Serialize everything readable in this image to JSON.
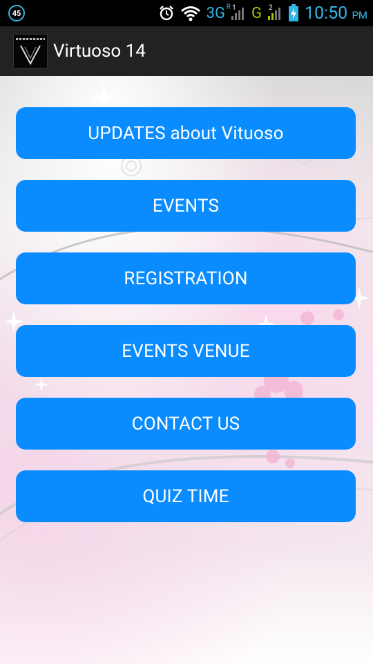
{
  "status_bar": {
    "notification_count": "45",
    "network_type": "3G",
    "network_sup": "R",
    "network2_type": "G",
    "network2_sup": "2",
    "sim1_sup": "1",
    "time": "10:50",
    "ampm": "PM"
  },
  "action_bar": {
    "title": "Virtuoso 14"
  },
  "menu": {
    "items": [
      {
        "label": "UPDATES about Vituoso"
      },
      {
        "label": "EVENTS"
      },
      {
        "label": "REGISTRATION"
      },
      {
        "label": "EVENTS VENUE"
      },
      {
        "label": "CONTACT US"
      },
      {
        "label": "QUIZ TIME"
      }
    ]
  },
  "colors": {
    "button_bg": "#0a8cff",
    "status_accent": "#33b5e5",
    "action_bar_bg": "#222222"
  }
}
